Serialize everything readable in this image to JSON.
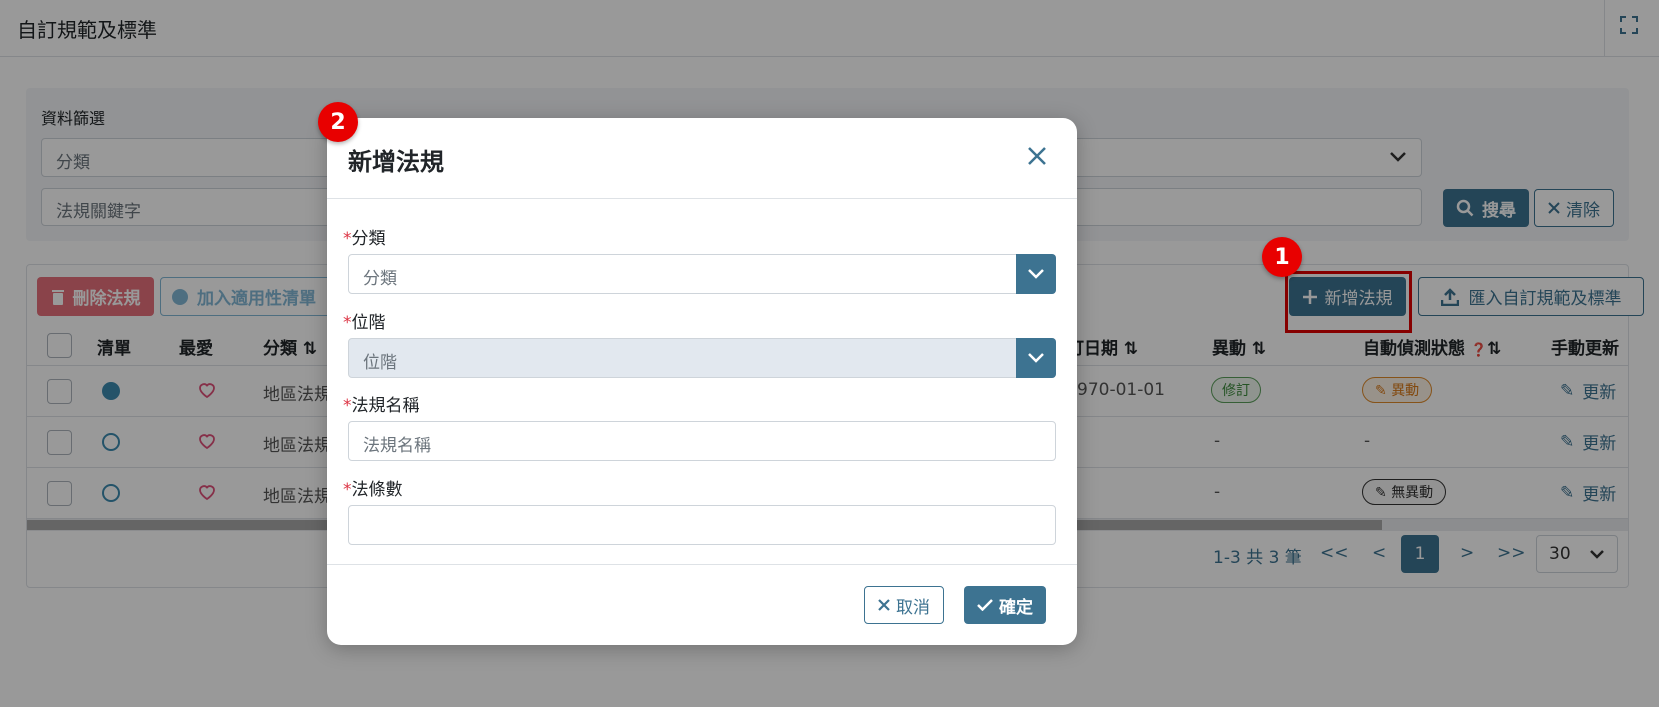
{
  "page": {
    "title": "自訂規範及標準"
  },
  "filter": {
    "label": "資料篩選",
    "category_placeholder": "分類",
    "keyword_placeholder": "法規關鍵字",
    "search_label": "搜尋",
    "clear_label": "清除"
  },
  "toolbar": {
    "delete_label": "刪除法規",
    "add_applicable_label": "加入適用性清單",
    "add_law_label": "新增法規",
    "import_label": "匯入自訂規範及標準"
  },
  "table": {
    "headers": {
      "list": "清單",
      "favorite": "最愛",
      "category": "分類",
      "revision_date": "訂日期",
      "change": "異動",
      "auto_detect": "自動偵測狀態",
      "manual_update": "手動更新"
    },
    "rows": [
      {
        "list_selected": true,
        "category": "地區法規",
        "date": "970-01-01",
        "change": "修訂",
        "detect": "異動",
        "update": "更新"
      },
      {
        "list_selected": false,
        "category": "地區法規",
        "date": "",
        "change": "-",
        "detect": "-",
        "update": "更新"
      },
      {
        "list_selected": false,
        "category": "地區法規",
        "date": "",
        "change": "-",
        "detect": "無異動",
        "update": "更新"
      }
    ]
  },
  "pagination": {
    "summary": "1-3 共 3 筆",
    "first": "<<",
    "prev": "<",
    "current": "1",
    "next": ">",
    "last": ">>",
    "page_size": "30"
  },
  "modal": {
    "title": "新增法規",
    "required_mark": "*",
    "category_label": "分類",
    "category_placeholder": "分類",
    "level_label": "位階",
    "level_placeholder": "位階",
    "law_name_label": "法規名稱",
    "law_name_placeholder": "法規名稱",
    "article_count_label": "法條數",
    "article_count_value": "",
    "cancel_label": "取消",
    "confirm_label": "確定"
  },
  "annotations": {
    "step1": "1",
    "step2": "2"
  },
  "colors": {
    "primary": "#3d7391",
    "danger": "#dc3545",
    "highlight": "#e00000"
  }
}
